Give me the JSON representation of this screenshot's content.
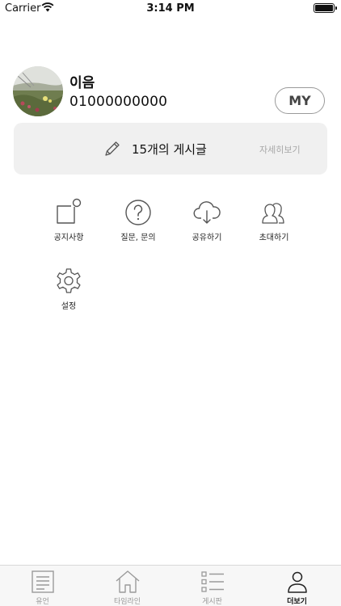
{
  "status_bar": {
    "carrier": "Carrier",
    "time": "3:14 PM",
    "battery_level": 0.9
  },
  "profile": {
    "name": "이음",
    "phone": "01000000000",
    "my_button_label": "MY"
  },
  "post_card": {
    "count_label": "15개의 게시글",
    "detail_label": "자세히보기"
  },
  "menu": {
    "items": [
      {
        "label": "공지사항",
        "icon": "notice-icon"
      },
      {
        "label": "질문, 문의",
        "icon": "question-icon"
      },
      {
        "label": "공유하기",
        "icon": "cloud-download-icon"
      },
      {
        "label": "초대하기",
        "icon": "people-icon"
      },
      {
        "label": "설정",
        "icon": "gear-icon"
      }
    ]
  },
  "tab_bar": {
    "items": [
      {
        "label": "유언",
        "icon": "document-icon"
      },
      {
        "label": "타임라인",
        "icon": "home-icon"
      },
      {
        "label": "게시판",
        "icon": "list-icon"
      },
      {
        "label": "더보기",
        "icon": "person-icon",
        "active": true
      }
    ]
  },
  "colors": {
    "card_background": "#f0f0f0",
    "icon_stroke": "#555555",
    "tab_bar_background": "#f7f7f7"
  }
}
